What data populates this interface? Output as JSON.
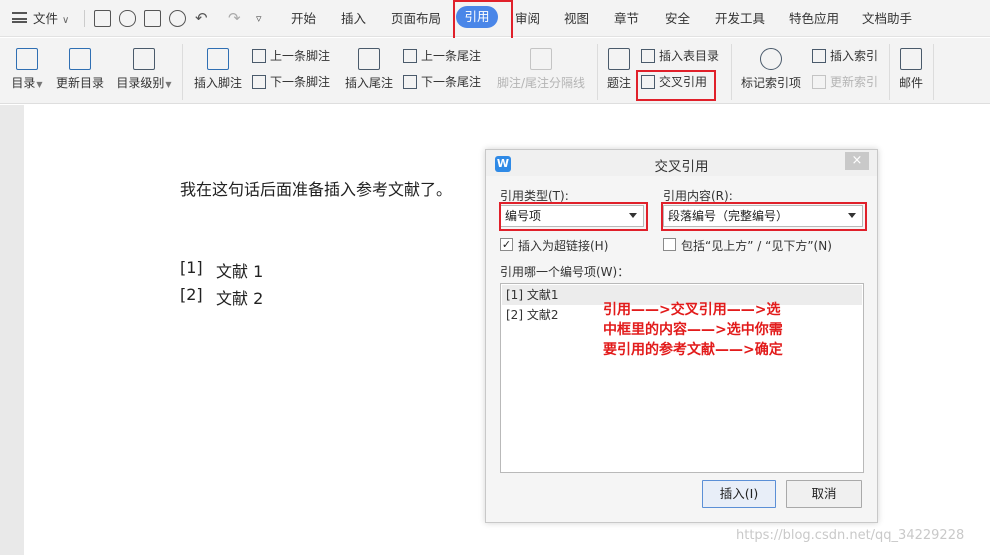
{
  "menubar": {
    "file_label": "文件",
    "tabs": [
      {
        "label": "开始"
      },
      {
        "label": "插入"
      },
      {
        "label": "页面布局"
      },
      {
        "label": "引用"
      },
      {
        "label": "审阅"
      },
      {
        "label": "视图"
      },
      {
        "label": "章节"
      },
      {
        "label": "安全"
      },
      {
        "label": "开发工具"
      },
      {
        "label": "特色应用"
      },
      {
        "label": "文档助手"
      }
    ],
    "active_tab": "引用"
  },
  "ribbon": {
    "toc": "目录",
    "update_toc": "更新目录",
    "toc_level": "目录级别",
    "insert_footnote": "插入脚注",
    "prev_footnote": "上一条脚注",
    "next_footnote": "下一条脚注",
    "insert_endnote": "插入尾注",
    "prev_endnote": "上一条尾注",
    "next_endnote": "下一条尾注",
    "footnote_separator": "脚注/尾注分隔线",
    "caption": "题注",
    "insert_table_of_figures": "插入表目录",
    "cross_reference": "交叉引用",
    "mark_index_entry": "标记索引项",
    "insert_index": "插入索引",
    "update_index": "更新索引",
    "mail": "邮件"
  },
  "document": {
    "sentence": "我在这句话后面准备插入参考文献了。",
    "references": [
      {
        "num": "[1]",
        "text": "文献 1"
      },
      {
        "num": "[2]",
        "text": "文献 2"
      }
    ]
  },
  "dialog": {
    "logo": "W",
    "title": "交叉引用",
    "close": "×",
    "ref_type_label": "引用类型(T):",
    "ref_type_value": "编号项",
    "ref_content_label": "引用内容(R):",
    "ref_content_value": "段落编号（完整编号）",
    "insert_hyperlink_label": "插入为超链接(H)",
    "insert_hyperlink_checked": true,
    "include_above_below_label": "包括“见上方” / “见下方”(N)",
    "include_above_below_checked": false,
    "which_item_label": "引用哪一个编号项(W)：",
    "items": [
      {
        "label": "[1] 文献1",
        "selected": true
      },
      {
        "label": "[2] 文献2",
        "selected": false
      }
    ],
    "annotation_lines": [
      "引用——>交叉引用——>选",
      "中框里的内容——>选中你需",
      "要引用的参考文献——>确定"
    ],
    "insert_button": "插入(I)",
    "cancel_button": "取消"
  },
  "watermark": "https://blog.csdn.net/qq_34229228",
  "colors": {
    "accent": "#4a86e8",
    "highlight_box": "#e0202a",
    "annotation_text": "#e21b1b"
  }
}
